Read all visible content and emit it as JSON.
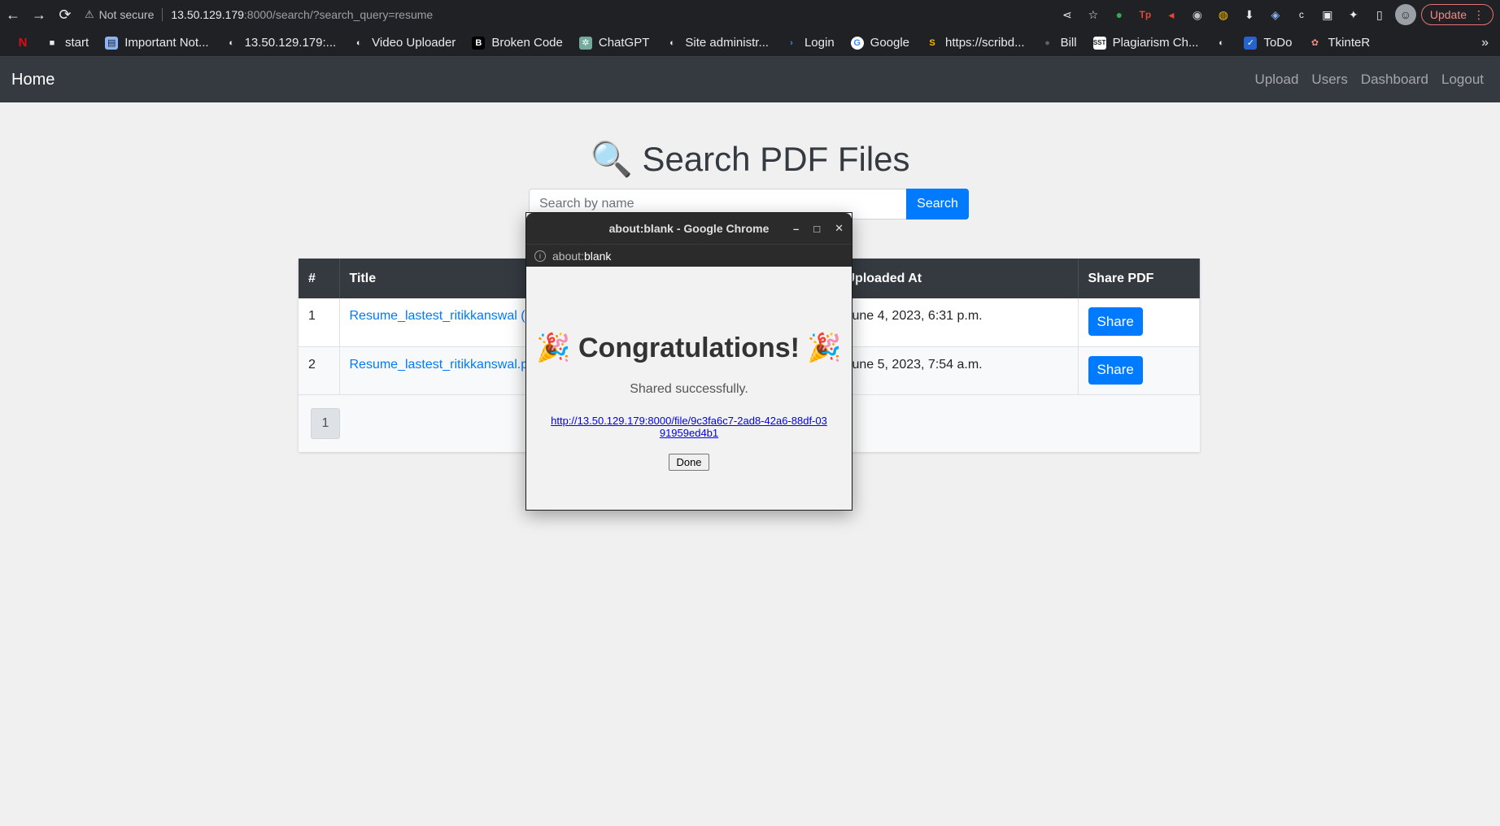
{
  "browser": {
    "security_label": "Not secure",
    "url_host": "13.50.129.179",
    "url_rest": ":8000/search/?search_query=resume",
    "update_label": "Update",
    "bookmarks": [
      "start",
      "Important Not...",
      "13.50.129.179:...",
      "Video Uploader",
      "Broken Code",
      "ChatGPT",
      "Site administr...",
      "Login",
      "Google",
      "https://scribd...",
      "Bill",
      "Plagiarism Ch...",
      "",
      "ToDo",
      "TkinteR"
    ]
  },
  "navbar": {
    "brand": "Home",
    "links": [
      "Upload",
      "Users",
      "Dashboard",
      "Logout"
    ]
  },
  "main": {
    "title": "🔍 Search PDF Files",
    "search_placeholder": "Search by name",
    "search_button": "Search"
  },
  "table": {
    "headers": [
      "#",
      "Title",
      "Uploaded At",
      "Share PDF"
    ],
    "rows": [
      {
        "num": "1",
        "title": "Resume_lastest_ritikkanswal (",
        "uploaded": "une 4, 2023, 6:31 p.m.",
        "share": "Share"
      },
      {
        "num": "2",
        "title": "Resume_lastest_ritikkanswal.p",
        "uploaded": "une 5, 2023, 7:54 a.m.",
        "share": "Share"
      }
    ],
    "page": "1"
  },
  "popup": {
    "window_title": "about:blank - Google Chrome",
    "url_prefix": "about:",
    "url_blank": "blank",
    "heading": "🎉 Congratulations! 🎉",
    "message": "Shared successfully.",
    "link": "http://13.50.129.179:8000/file/9c3fa6c7-2ad8-42a6-88df-0391959ed4b1",
    "done": "Done"
  }
}
